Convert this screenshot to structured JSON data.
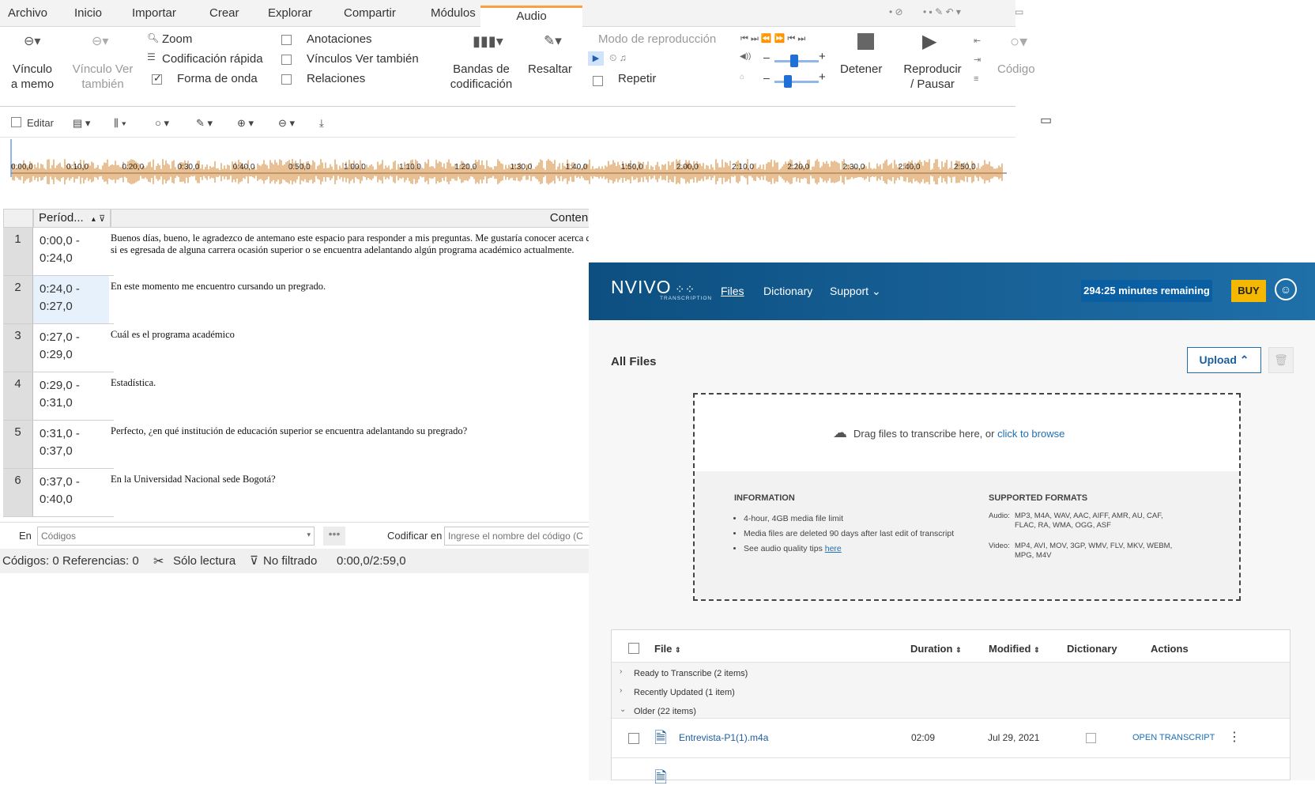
{
  "menu": {
    "items": [
      "Archivo",
      "Inicio",
      "Importar",
      "Crear",
      "Explorar",
      "Compartir",
      "Módulos"
    ],
    "active": "Audio"
  },
  "ribbon": {
    "vinculo_memo": [
      "Vínculo",
      "a memo"
    ],
    "vinculo_ver": [
      "Vínculo Ver",
      "también"
    ],
    "zoom": "Zoom",
    "codificacion_rapida": "Codificación rápida",
    "forma_de_onda": "Forma de onda",
    "anotaciones": "Anotaciones",
    "vinculos_ver": "Vínculos Ver también",
    "relaciones": "Relaciones",
    "bandas": [
      "Bandas de",
      "codificación"
    ],
    "resaltar": "Resaltar",
    "modo": "Modo de reproducción",
    "repetir": "Repetir",
    "detener": "Detener",
    "reproducir": [
      "Reproducir",
      "/ Pausar"
    ],
    "codigo": "Código",
    "co_trunc": [
      "Co",
      "en"
    ],
    "checks": {
      "forma_de_onda": true,
      "anotaciones": false,
      "vinculos_ver": false,
      "relaciones": false,
      "repetir": false
    }
  },
  "toolbar2": {
    "editar": "Editar"
  },
  "waveform": {
    "ticks": [
      "0:00,0",
      "0:10,0",
      "0:20,0",
      "0:30,0",
      "0:40,0",
      "0:50,0",
      "1:00,0",
      "1:10,0",
      "1:20,0",
      "1:30,0",
      "1:40,0",
      "1:50,0",
      "2:00,0",
      "2:10,0",
      "2:20,0",
      "2:30,0",
      "2:40,0",
      "2:50,0"
    ],
    "color": "#d2812a"
  },
  "grid": {
    "col_periodo": "Períod...",
    "col_contenido": "Contenido",
    "rows": [
      {
        "num": "1",
        "time": [
          "0:00,0 -",
          "0:24,0"
        ],
        "text": "Buenos días, bueno, le agradezco de antemano este espacio para responder a mis preguntas. Me gustaría conocer acerca de la preferencia académica por una carrera a una institución de educación superior y me gustaría primero pues conocer si es egresada de alguna carrera ocasión superior o se encuentra adelantando algún programa académico actualmente."
      },
      {
        "num": "2",
        "time": [
          "0:24,0 -",
          "0:27,0"
        ],
        "text": "En este momento me encuentro cursando un pregrado."
      },
      {
        "num": "3",
        "time": [
          "0:27,0 -",
          "0:29,0"
        ],
        "text": "Cuál es el programa académico"
      },
      {
        "num": "4",
        "time": [
          "0:29,0 -",
          "0:31,0"
        ],
        "text": "Estadística."
      },
      {
        "num": "5",
        "time": [
          "0:31,0 -",
          "0:37,0"
        ],
        "text": "Perfecto, ¿en qué institución de educación superior se encuentra adelantando su pregrado?"
      },
      {
        "num": "6",
        "time": [
          "0:37,0 -",
          "0:40,0"
        ],
        "text": "En la Universidad Nacional sede Bogotá?"
      }
    ]
  },
  "codebar": {
    "en": "En",
    "codigos_placeholder": "Códigos",
    "codificar_en": "Codificar en",
    "codigo_placeholder": "Ingrese el nombre del código (C"
  },
  "status": {
    "codigos": "Códigos: 0",
    "referencias": "Referencias: 0",
    "solo_lectura": "Sólo lectura",
    "no_filtrado": "No filtrado",
    "tiempo": "0:00,0/2:59,0"
  },
  "web": {
    "logo": "NVIVO",
    "logo_sub": "TRANSCRIPTION",
    "nav": [
      "Files",
      "Dictionary",
      "Support"
    ],
    "minutes": "294:25 minutes remaining",
    "buy": "BUY",
    "all_files": "All Files",
    "upload": "Upload",
    "drag_text": "Drag files to transcribe here, or ",
    "browse": "click to browse",
    "info_title": "INFORMATION",
    "info": [
      "4-hour, 4GB media file limit",
      "Media files are deleted 90 days after last edit of transcript",
      "See audio quality tips "
    ],
    "here": "here",
    "formats_title": "SUPPORTED FORMATS",
    "audio_label": "Audio:",
    "audio_formats": "MP3, M4A, WAV, AAC, AIFF, AMR, AU, CAF, FLAC, RA, WMA, OGG, ASF",
    "video_label": "Video:",
    "video_formats": "MP4, AVI, MOV, 3GP, WMV, FLV, MKV, WEBM, MPG, M4V",
    "table": {
      "headers": [
        "File",
        "Duration",
        "Modified",
        "Dictionary",
        "Actions"
      ],
      "groups": [
        "Ready to Transcribe (2 items)",
        "Recently Updated (1 item)",
        "Older (22 items)"
      ],
      "file": {
        "name": "Entrevista-P1(1).m4a",
        "duration": "02:09",
        "modified": "Jul 29, 2021",
        "action": "OPEN TRANSCRIPT"
      }
    }
  }
}
